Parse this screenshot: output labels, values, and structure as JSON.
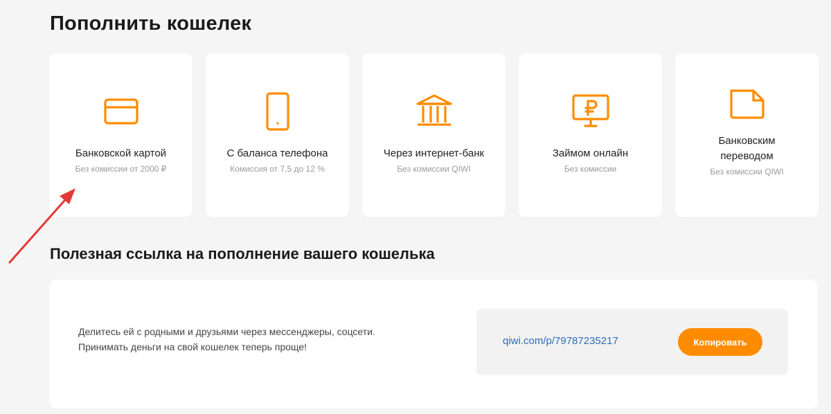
{
  "page_title": "Пополнить кошелек",
  "methods": [
    {
      "label": "Банковской картой",
      "sub": "Без комиссии от 2000 ₽",
      "icon": "credit-card-icon"
    },
    {
      "label": "С баланса телефона",
      "sub": "Комиссия от 7,5 до 12 %",
      "icon": "phone-icon"
    },
    {
      "label": "Через интернет-банк",
      "sub": "Без комиссии QIWI",
      "icon": "bank-icon"
    },
    {
      "label": "Займом онлайн",
      "sub": "Без комиссии",
      "icon": "ruble-monitor-icon"
    },
    {
      "label": "Банковским переводом",
      "sub": "Без комиссии QIWI",
      "icon": "document-icon"
    }
  ],
  "useful_link": {
    "title": "Полезная ссылка на пополнение вашего кошелька",
    "desc_line1": "Делитесь ей с родными и друзьями через мессенджеры, соцсети.",
    "desc_line2": "Принимать деньги на свой кошелек теперь проще!",
    "url": "qiwi.com/p/79787235217",
    "copy_label": "Копировать"
  },
  "colors": {
    "accent": "#ff8c00",
    "link": "#2e6cb8",
    "annotation_arrow": "#e53935"
  }
}
